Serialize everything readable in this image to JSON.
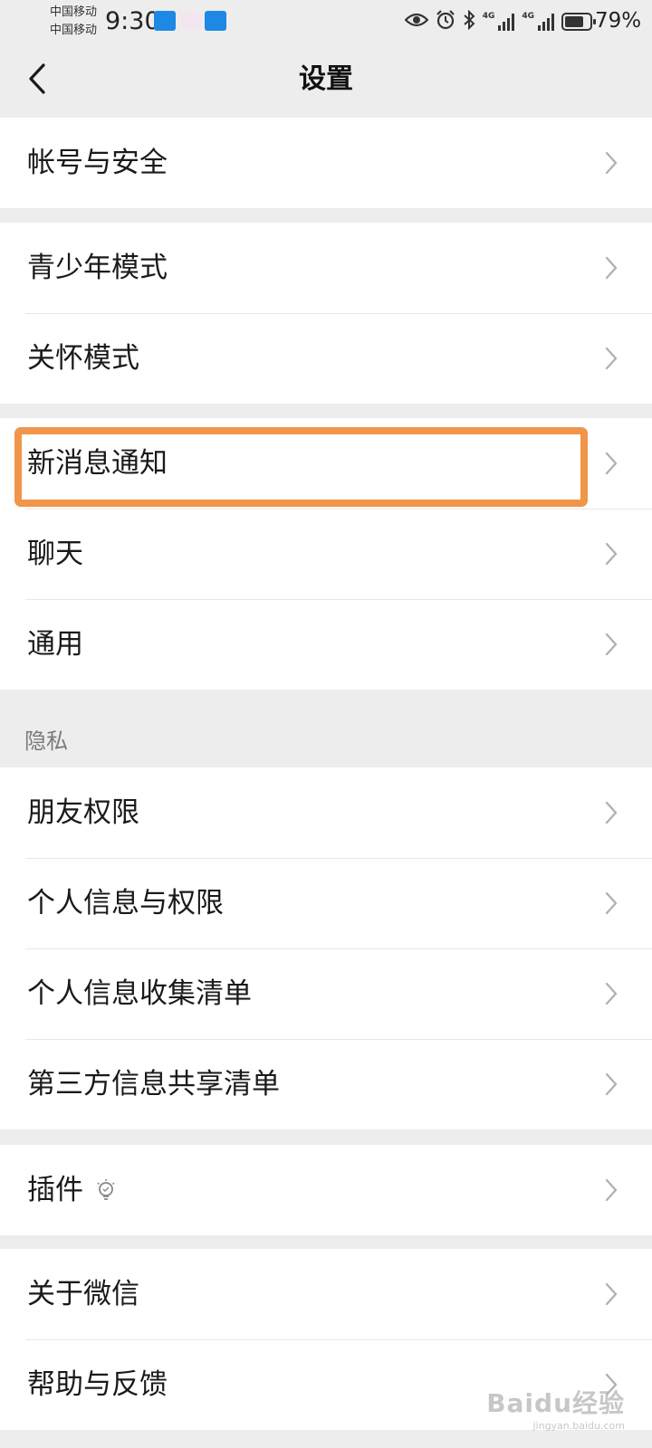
{
  "status_bar": {
    "carrier_1": "中国移动",
    "carrier_2": "中国移动",
    "time": "9:30",
    "network_1": "4G",
    "network_2": "4G",
    "battery_percent": "79%",
    "battery_level": 0.79
  },
  "nav": {
    "title": "设置"
  },
  "groups": {
    "account": {
      "items": [
        "帐号与安全"
      ]
    },
    "modes": {
      "items": [
        "青少年模式",
        "关怀模式"
      ]
    },
    "general": {
      "items": [
        "新消息通知",
        "聊天",
        "通用"
      ]
    },
    "privacy": {
      "header": "隐私",
      "items": [
        "朋友权限",
        "个人信息与权限",
        "个人信息收集清单",
        "第三方信息共享清单"
      ]
    },
    "plugins": {
      "items": [
        "插件"
      ]
    },
    "about": {
      "items": [
        "关于微信",
        "帮助与反馈"
      ]
    }
  },
  "highlight_color": "#f0954a",
  "watermark": {
    "main": "Baidu经验",
    "sub": "jingyan.baidu.com"
  }
}
